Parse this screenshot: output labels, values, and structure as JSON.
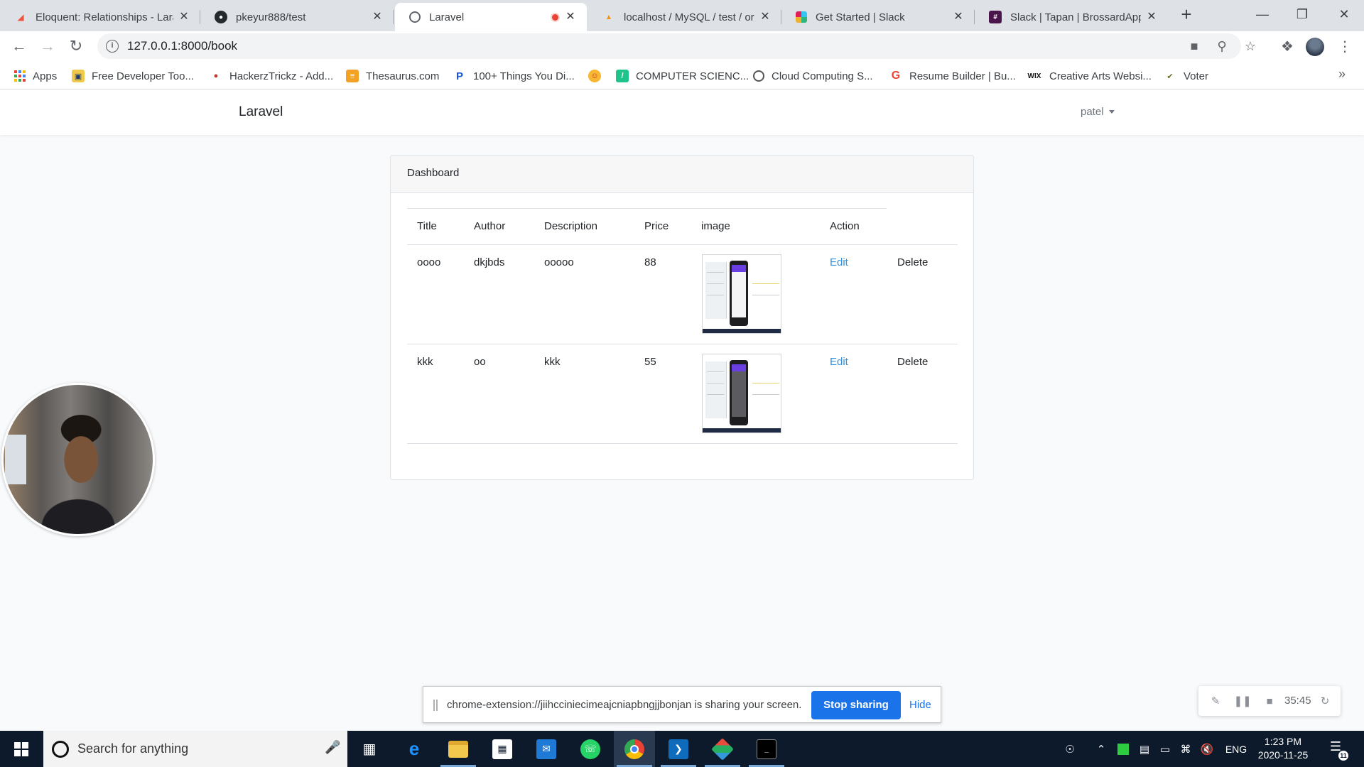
{
  "browser": {
    "tabs": [
      {
        "title": "Eloquent: Relationships - Lara",
        "favicon": "laravel-icon"
      },
      {
        "title": "pkeyur888/test",
        "favicon": "github-icon"
      },
      {
        "title": "Laravel",
        "favicon": "globe-icon",
        "active": true,
        "recording": true
      },
      {
        "title": "localhost / MySQL / test / or",
        "favicon": "phpmyadmin-icon"
      },
      {
        "title": "Get Started | Slack",
        "favicon": "slack-icon"
      },
      {
        "title": "Slack | Tapan | BrossardAppD",
        "favicon": "slack-workspace-icon"
      }
    ],
    "url": "127.0.0.1:8000/book",
    "bookmarks": [
      {
        "label": "Apps",
        "icon": "apps-grid-icon"
      },
      {
        "label": "Free Developer Too...",
        "icon": "bookmark-favicon"
      },
      {
        "label": "HackerzTrickz - Add...",
        "icon": "bookmark-favicon"
      },
      {
        "label": "Thesaurus.com",
        "icon": "bookmark-favicon"
      },
      {
        "label": "100+ Things You Di...",
        "icon": "bookmark-favicon"
      },
      {
        "label": "",
        "icon": "emoji-favicon"
      },
      {
        "label": "COMPUTER SCIENC...",
        "icon": "bookmark-favicon"
      },
      {
        "label": "Cloud Computing S...",
        "icon": "bookmark-favicon"
      },
      {
        "label": "Resume Builder | Bu...",
        "icon": "google-icon"
      },
      {
        "label": "Creative Arts Websi...",
        "icon": "wix-icon"
      },
      {
        "label": "Voter",
        "icon": "bookmark-favicon"
      }
    ]
  },
  "app": {
    "brand": "Laravel",
    "user": "patel",
    "card_title": "Dashboard",
    "table": {
      "headers": [
        "Title",
        "Author",
        "Description",
        "Price",
        "image",
        "Action"
      ],
      "rows": [
        {
          "title": "oooo",
          "author": "dkjbds",
          "description": "ooooo",
          "price": "88",
          "edit": "Edit",
          "delete": "Delete"
        },
        {
          "title": "kkk",
          "author": "oo",
          "description": "kkk",
          "price": "55",
          "edit": "Edit",
          "delete": "Delete"
        }
      ]
    }
  },
  "share_bar": {
    "message": "chrome-extension://jiihcciniecimeajcniapbngjjbonjan is sharing your screen.",
    "stop_label": "Stop sharing",
    "hide_label": "Hide"
  },
  "recorder": {
    "time": "35:45"
  },
  "taskbar": {
    "search_placeholder": "Search for anything",
    "language": "ENG",
    "time": "1:23 PM",
    "date": "2020-11-25",
    "notification_count": "11"
  },
  "colors": {
    "link": "#3490dc",
    "share_button": "#1a73e8",
    "taskbar": "#0c1a2b"
  }
}
